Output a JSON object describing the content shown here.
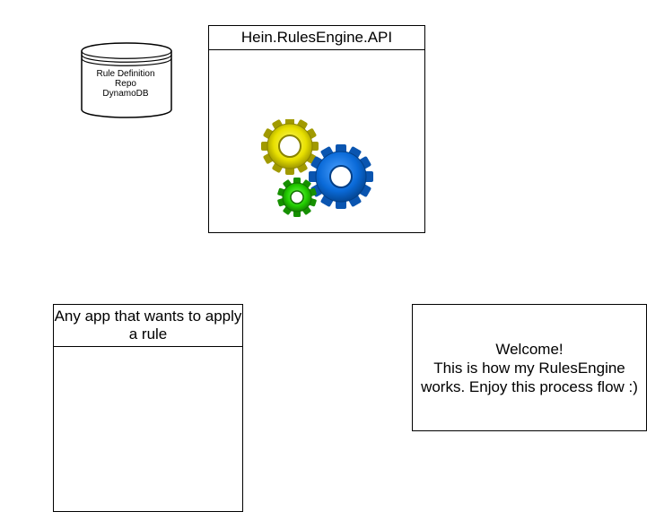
{
  "database": {
    "label_lines": [
      "Rule Definition",
      "Repo",
      "DynamoDB"
    ]
  },
  "api": {
    "title": "Hein.RulesEngine.API",
    "gear_icon": "gears-icon",
    "colors": {
      "yellow_gear": "#e8e000",
      "blue_gear": "#0a6ad8",
      "green_gear": "#22cc00"
    }
  },
  "app": {
    "title": "Any app that wants to apply a rule"
  },
  "note": {
    "lines": [
      "Welcome!",
      "This is how my RulesEngine works. Enjoy this process flow :)"
    ]
  }
}
